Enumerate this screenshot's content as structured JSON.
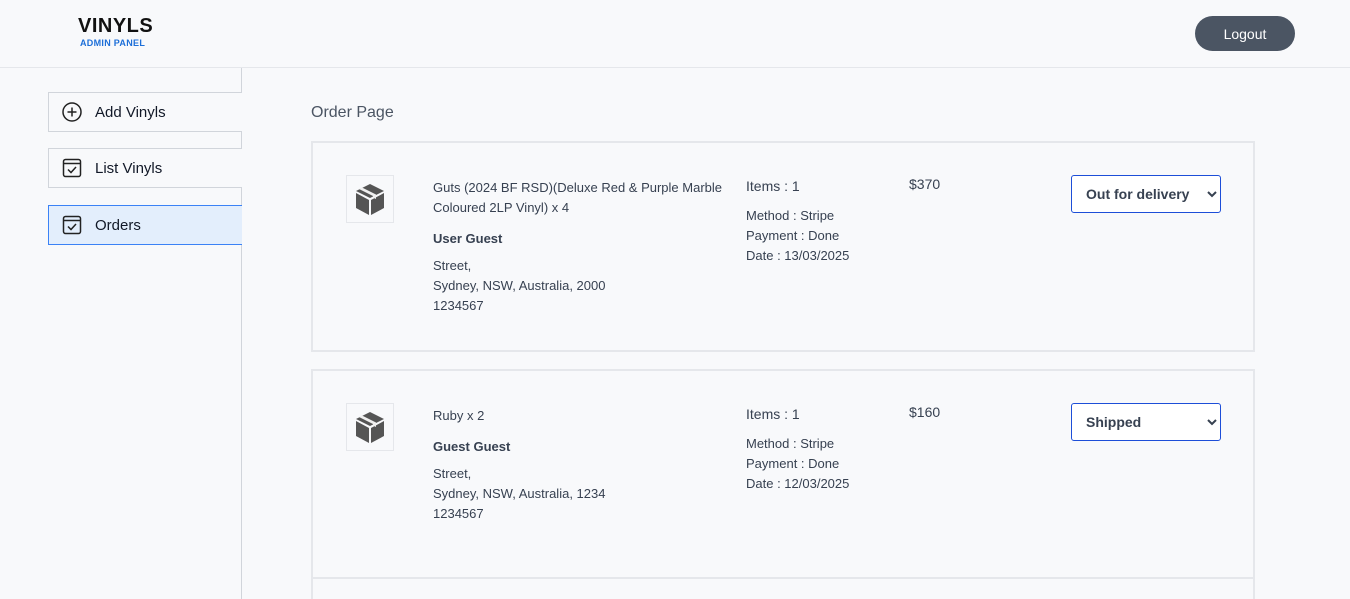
{
  "header": {
    "logo_title": "VINYLS",
    "logo_subtitle": "ADMIN PANEL",
    "logout_label": "Logout"
  },
  "sidebar": {
    "items": [
      {
        "label": "Add Vinyls",
        "icon": "plus-circle-icon"
      },
      {
        "label": "List Vinyls",
        "icon": "checklist-icon"
      },
      {
        "label": "Orders",
        "icon": "checklist-icon",
        "active": true
      }
    ]
  },
  "main": {
    "title": "Order Page",
    "orders": [
      {
        "items_text": "Guts (2024 BF RSD)(Deluxe Red & Purple Marble Coloured 2LP Vinyl) x 4",
        "customer": "User Guest",
        "street": "Street,",
        "city_line": "Sydney, NSW, Australia, 2000",
        "phone": "1234567",
        "items_count": "Items : 1",
        "method": "Method : Stripe",
        "payment": "Payment : Done",
        "date": "Date : 13/03/2025",
        "amount": "$370",
        "status": "Out for delivery"
      },
      {
        "items_text": "Ruby x 2",
        "customer": "Guest Guest",
        "street": "Street,",
        "city_line": "Sydney, NSW, Australia, 1234",
        "phone": "1234567",
        "items_count": "Items : 1",
        "method": "Method : Stripe",
        "payment": "Payment : Done",
        "date": "Date : 12/03/2025",
        "amount": "$160",
        "status": "Shipped"
      }
    ]
  },
  "colors": {
    "accent": "#1d6fd8",
    "logout_bg": "#4b5563",
    "active_bg": "#e3eefc",
    "active_border": "#3b82f6"
  }
}
